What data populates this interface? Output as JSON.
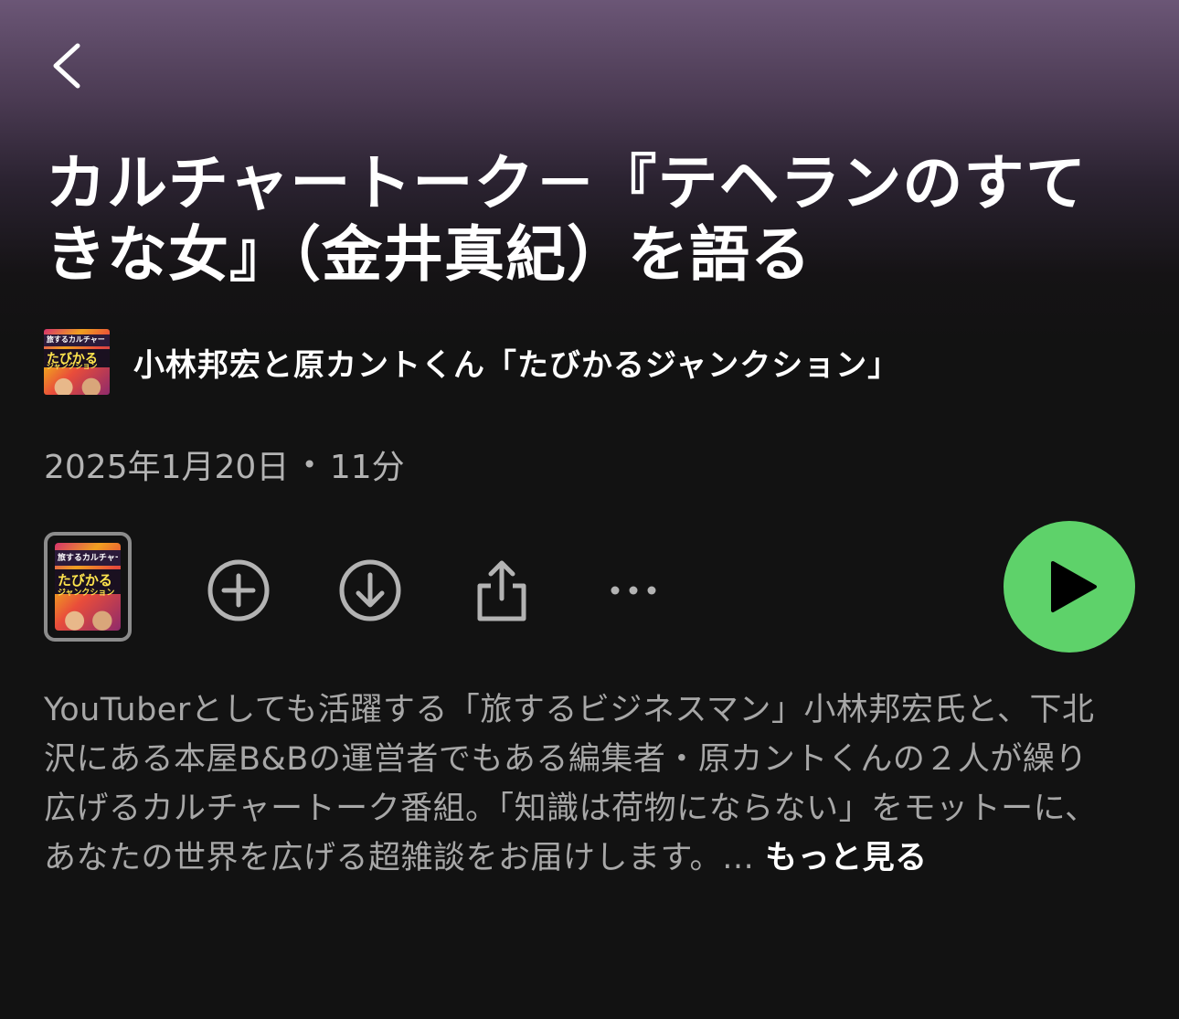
{
  "header": {
    "back_icon": "chevron-left-icon"
  },
  "episode": {
    "title": "カルチャートーク－『テヘランのすてきな女』（金井真紀）を語る",
    "date": "2025年1月20日",
    "separator": "•",
    "duration": "11分",
    "description": "YouTuberとしても活躍する「旅するビジネスマン」小林邦宏氏と、下北沢にある本屋B&Bの運営者でもある編集者・原カントくんの２人が繰り広げるカルチャートーク番組。「知識は荷物にならない」をモットーに、あなたの世界を広げる超雑談をお届けします。…",
    "more_label": "もっと見る"
  },
  "show": {
    "name": "小林邦宏と原カントくん「たびかるジャンクション」",
    "art_text_top": "旅するカルチャートーク",
    "art_text_main": "たびかる",
    "art_text_sub": "ジャンクション"
  },
  "controls": {
    "add_icon": "plus-circle-icon",
    "download_icon": "download-circle-icon",
    "share_icon": "share-icon",
    "more_icon": "more-horizontal-icon",
    "play_icon": "play-icon"
  },
  "colors": {
    "background": "#121212",
    "gradient_top": "#6b5676",
    "accent_green": "#5ed26a",
    "secondary_text": "#a7a7a7"
  }
}
